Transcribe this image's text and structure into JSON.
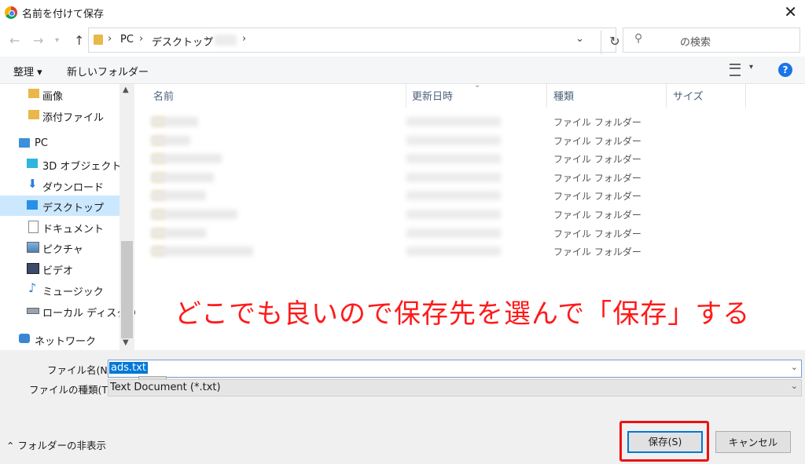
{
  "window": {
    "title": "名前を付けて保存"
  },
  "address": {
    "crumbs": [
      "PC",
      "デスクトップ"
    ],
    "search_placeholder": "の検索"
  },
  "toolbar": {
    "organize": "整理 ▾",
    "new_folder": "新しいフォルダー"
  },
  "nav": {
    "items": [
      {
        "label": "画像",
        "icon": "folder-icon"
      },
      {
        "label": "添付ファイル",
        "icon": "folder-icon"
      },
      {
        "label": "PC",
        "icon": "pc-icon"
      },
      {
        "label": "3D オブジェクト",
        "icon": "cube-icon"
      },
      {
        "label": "ダウンロード",
        "icon": "download-arrow-icon"
      },
      {
        "label": "デスクトップ",
        "icon": "desktop-icon",
        "selected": true
      },
      {
        "label": "ドキュメント",
        "icon": "document-icon"
      },
      {
        "label": "ピクチャ",
        "icon": "picture-icon"
      },
      {
        "label": "ビデオ",
        "icon": "film-icon"
      },
      {
        "label": "ミュージック",
        "icon": "music-note-icon"
      },
      {
        "label": "ローカル ディスク (C",
        "icon": "drive-icon"
      },
      {
        "label": "ネットワーク",
        "icon": "network-icon"
      }
    ]
  },
  "files": {
    "columns": {
      "name": "名前",
      "date": "更新日時",
      "type": "種類",
      "size": "サイズ"
    },
    "rows": [
      {
        "type": "ファイル フォルダー"
      },
      {
        "type": "ファイル フォルダー"
      },
      {
        "type": "ファイル フォルダー"
      },
      {
        "type": "ファイル フォルダー"
      },
      {
        "type": "ファイル フォルダー"
      },
      {
        "type": "ファイル フォルダー"
      },
      {
        "type": "ファイル フォルダー"
      },
      {
        "type": "ファイル フォルダー"
      }
    ]
  },
  "annotation": "どこでも良いので保存先を選んで「保存」する",
  "form": {
    "filename_label": "ファイル名(N):",
    "filename_value": "ads.txt",
    "filetype_label": "ファイルの種類(T):",
    "filetype_value": "Text Document (*.txt)"
  },
  "footer": {
    "hide_folders": "フォルダーの非表示",
    "save": "保存(S)",
    "cancel": "キャンセル"
  },
  "colors": {
    "accent": "#0078d7",
    "annotation": "#ff1a1a",
    "highlight": "#ee1111"
  }
}
